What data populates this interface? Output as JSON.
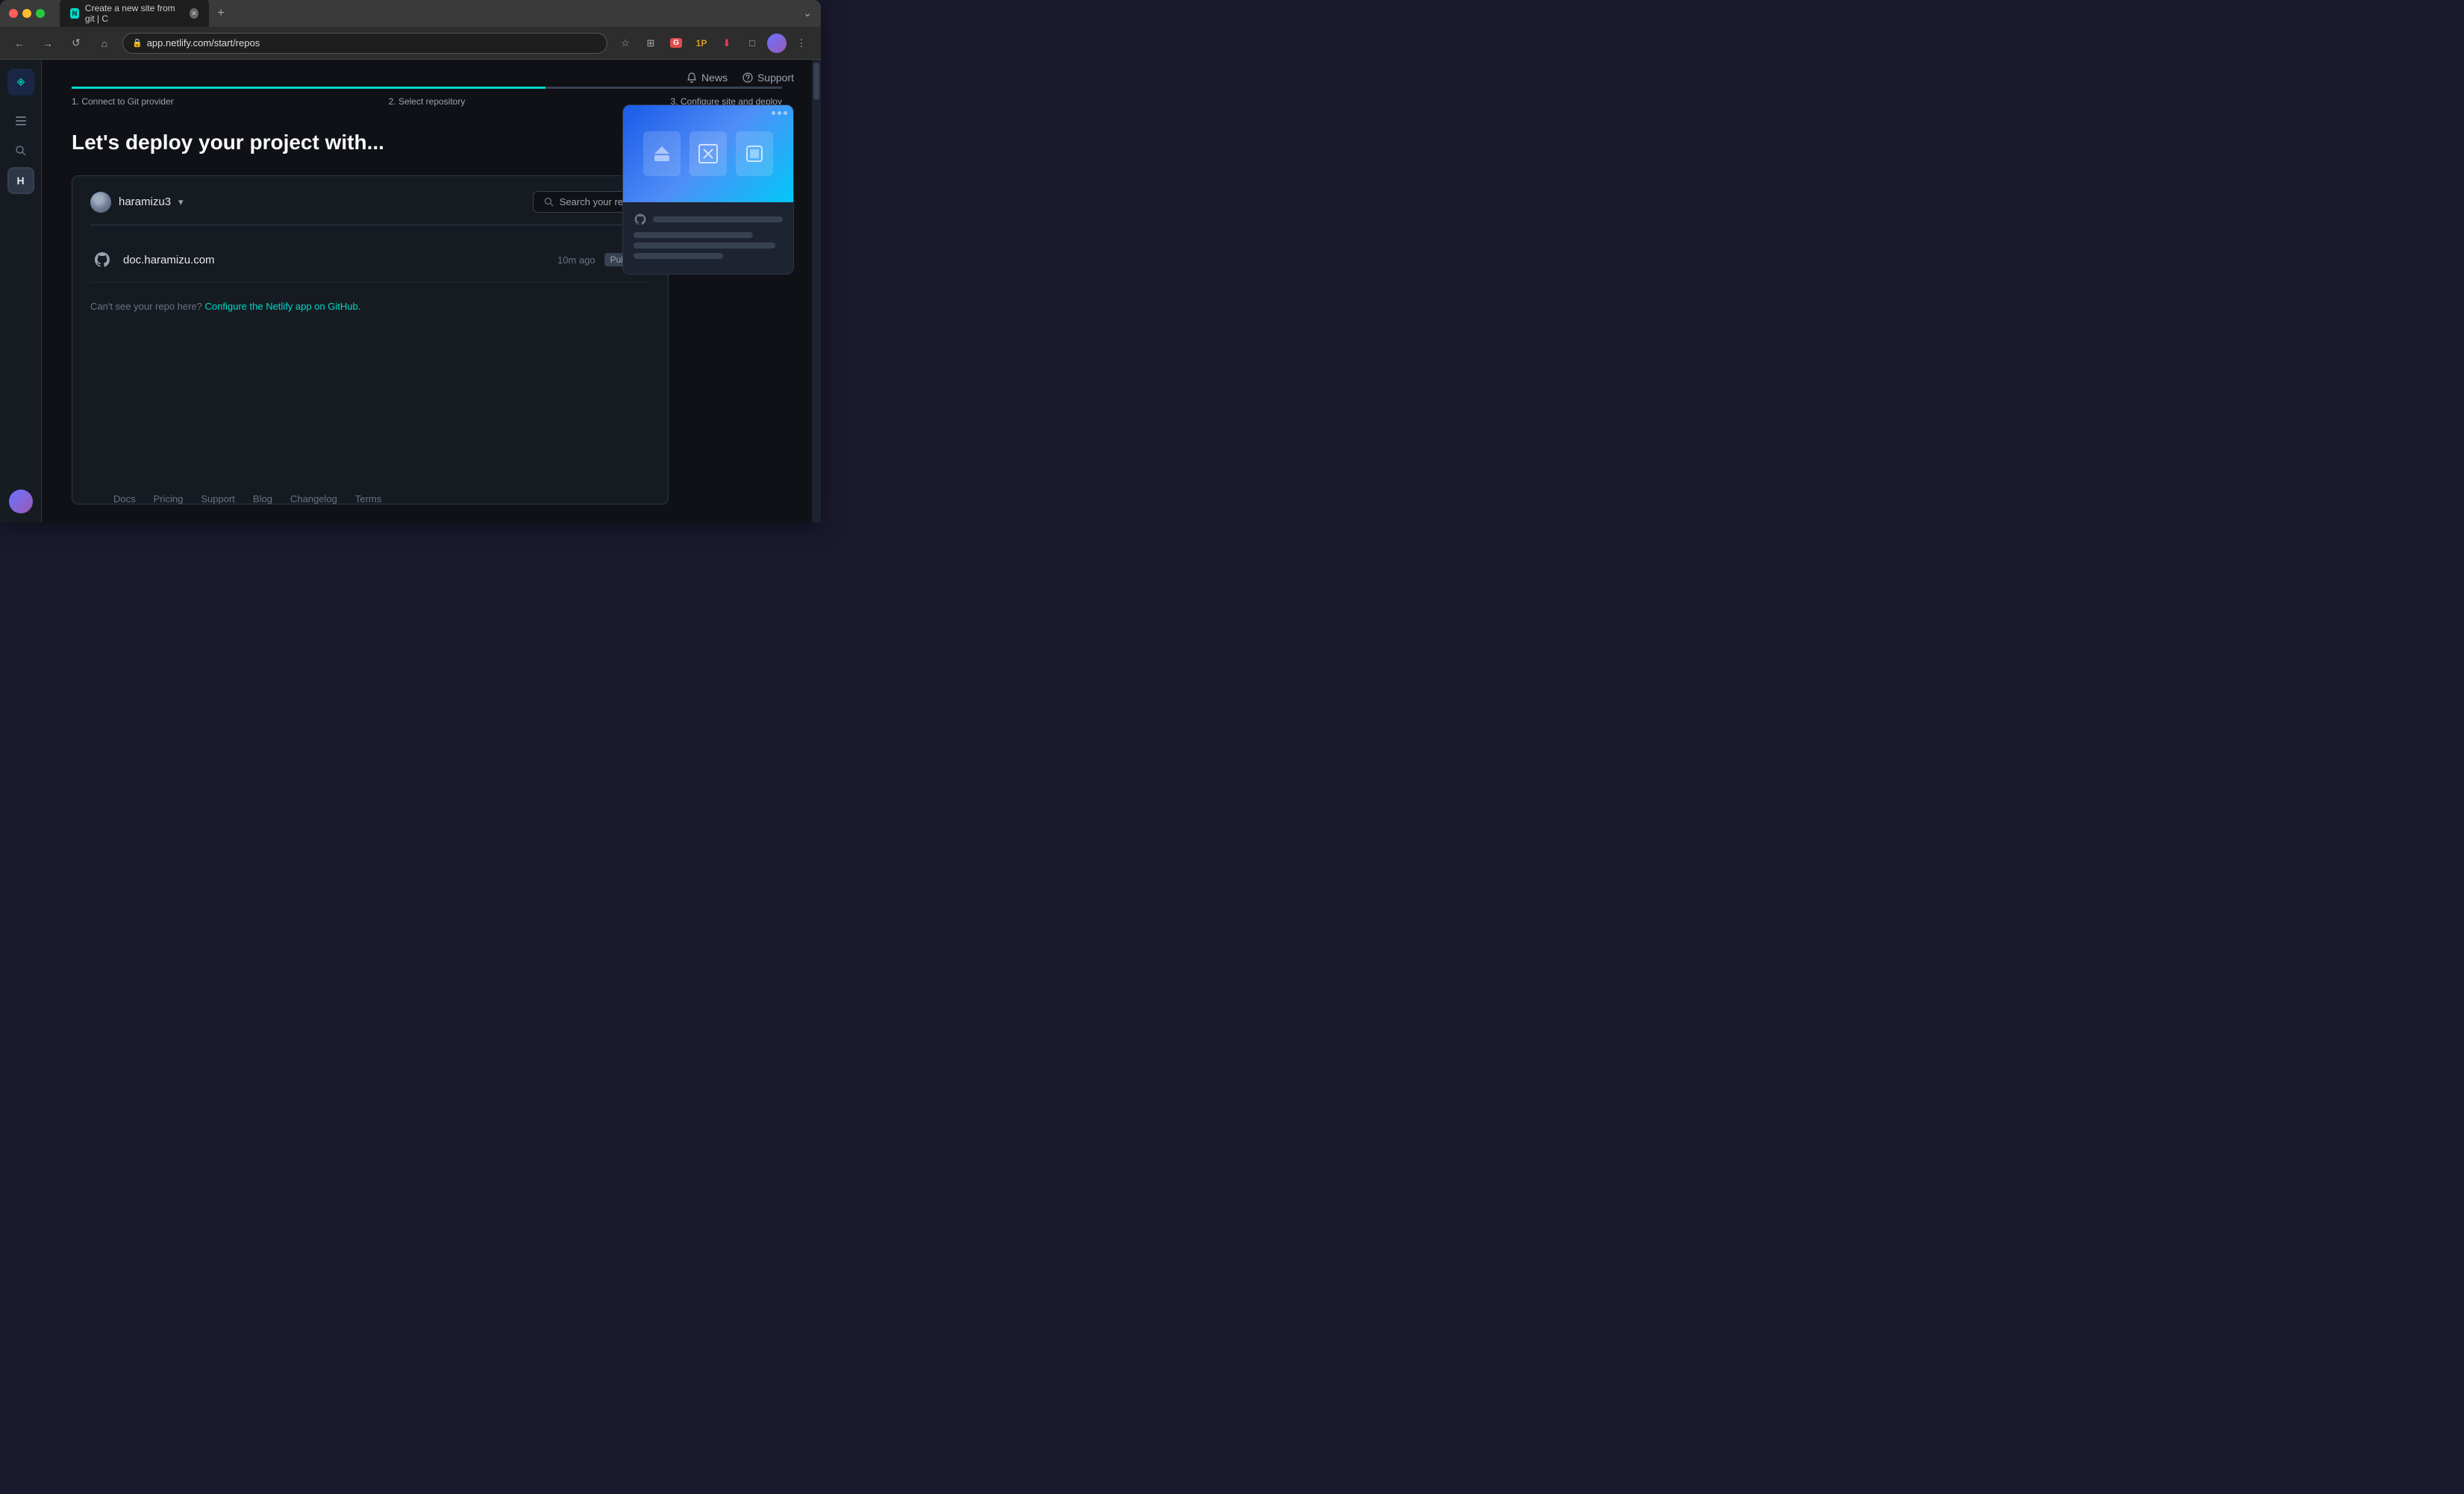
{
  "browser": {
    "tab_title": "Create a new site from git | C",
    "url": "app.netlify.com/start/repos",
    "tab_favicon": "N",
    "new_tab_label": "+"
  },
  "header": {
    "news_label": "News",
    "support_label": "Support"
  },
  "progress": {
    "step1_label": "1. Connect to Git provider",
    "step2_label": "2. Select repository",
    "step3_label": "3. Configure site and deploy"
  },
  "main": {
    "headline": "Let's deploy your project with...",
    "account_name": "haramizu3",
    "search_placeholder": "Search your repos"
  },
  "repos": [
    {
      "name": "doc.haramizu.com",
      "time": "10m ago",
      "badge": "Public"
    }
  ],
  "missing_repo_text": "Can't see your repo here?",
  "missing_repo_link": "Configure the Netlify app on GitHub.",
  "footer": {
    "links": [
      "Docs",
      "Pricing",
      "Support",
      "Blog",
      "Changelog",
      "Terms"
    ]
  },
  "sidebar": {
    "items": [
      {
        "icon": "⚡",
        "label": "home"
      },
      {
        "icon": "▤",
        "label": "sidebar-toggle"
      },
      {
        "icon": "🔍",
        "label": "search"
      },
      {
        "icon": "H",
        "label": "team"
      }
    ]
  }
}
